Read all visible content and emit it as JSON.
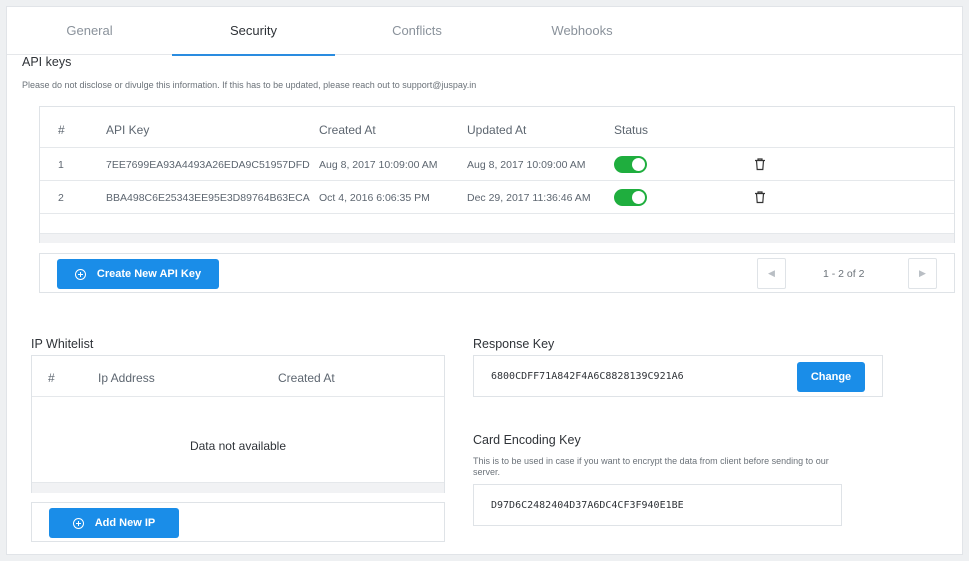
{
  "tabs": [
    {
      "label": "General"
    },
    {
      "label": "Security"
    },
    {
      "label": "Conflicts"
    },
    {
      "label": "Webhooks"
    }
  ],
  "api_keys": {
    "title": "API keys",
    "hint": "Please do not disclose or divulge this information. If this has to be updated, please reach out to support@juspay.in",
    "columns": [
      "#",
      "API Key",
      "Created At",
      "Updated At",
      "Status"
    ],
    "rows": [
      {
        "num": "1",
        "key": "7EE7699EA93A4493A26EDA9C51957DFD",
        "created": "Aug 8, 2017  10:09:00 AM",
        "updated": "Aug 8, 2017  10:09:00 AM",
        "enabled": true
      },
      {
        "num": "2",
        "key": "BBA498C6E25343EE95E3D89764B63ECA",
        "created": "Oct 4, 2016  6:06:35 PM",
        "updated": "Dec 29, 2017  11:36:46 AM",
        "enabled": true
      }
    ],
    "create_button": "Create New API Key",
    "pagination": {
      "label": "1 - 2 of 2",
      "prev": "◀",
      "next": "▶"
    }
  },
  "ip_whitelist": {
    "title": "IP Whitelist",
    "columns": [
      "#",
      "Ip Address",
      "Created At"
    ],
    "empty_text": "Data not available",
    "add_button": "Add New IP"
  },
  "response_key": {
    "title": "Response Key",
    "value": "6800CDFF71A842F4A6C8828139C921A6",
    "change_button": "Change"
  },
  "card_encoding_key": {
    "title": "Card Encoding Key",
    "hint": "This is to be used in case if you want to encrypt the data from client before sending to our server.",
    "value": "D97D6C2482404D37A6DC4CF3F940E1BE"
  },
  "colors": {
    "accent": "#1a8de8",
    "toggle_on": "#1fae3e"
  }
}
